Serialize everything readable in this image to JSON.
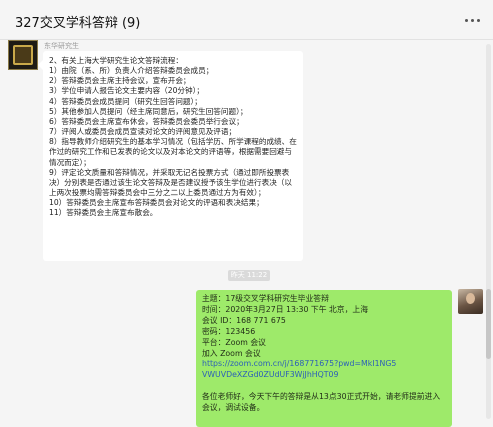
{
  "window": {
    "title": "327交叉学科答辩 (9)"
  },
  "messages": {
    "left": {
      "sender": "东华研究生",
      "lines": [
        "2、有关上海大学研究生论文答辩流程：",
        "1）由院（系、所）负责人介绍答辩委员会成员；",
        "2）答辩委员会主席主持会议，宣布开会；",
        "3）学位申请人报告论文主要内容（20分钟）；",
        "4）答辩委员会成员提问（研究生回答问题）；",
        "5）其他参加人员提问（经主席同意后，研究生回答问题）；",
        "6）答辩委员会主席宣布休会，答辩委员会委员举行会议；",
        "7）评阅人或委员会成员宣读对论文的评阅意见及评语；",
        "8）指导教师介绍研究生的基本学习情况（包括学历、所学课程的成绩、在作过的研究工作和已发表的论文以及对本论文的评语等，根据需要回避与情况而定）；",
        "9）评定论文质量和答辩情况，并采取无记名投票方式（通过即所投票表决）分别表是否通过该生论文答辩及是否建议授予该生学位进行表决（以上两次投票均需答辩委员会中三分之二以上委员通过方为有效）；",
        "10）答辩委员会主席宣布答辩委员会对论文的评语和表决结果；",
        "11）答辩委员会主席宣布散会。"
      ]
    },
    "timestamp": "昨天 11:22",
    "right": {
      "lines": [
        "主题：17级交叉学科研究生毕业答辩",
        "时间：2020年3月27日 13:30 下午 北京，上海",
        "会议 ID：168 771 675",
        "密码：123456",
        "平台：Zoom 会议",
        "加入 Zoom 会议"
      ],
      "link": "https://zoom.com.cn/j/168771675?pwd=MkI1NG5VWUVDeXZGd0ZUdUF3WjJhHQT09",
      "link_lines": [
        "https://zoom.com.cn/j/168771675?pwd=MkI1NG5",
        "VWUVDeXZGd0ZUdUF3WjJhHQT09"
      ],
      "notice": "各位老师好，今天下午的答辩是从13点30正式开始，请老师提前进入会议，调试设备。"
    }
  },
  "colors": {
    "background": "#f5f5f5",
    "bubble_self": "#9eea6a",
    "bubble_other": "#ffffff",
    "link": "#2b5fb8"
  },
  "icons": {
    "menu": "more-dots-icon"
  }
}
